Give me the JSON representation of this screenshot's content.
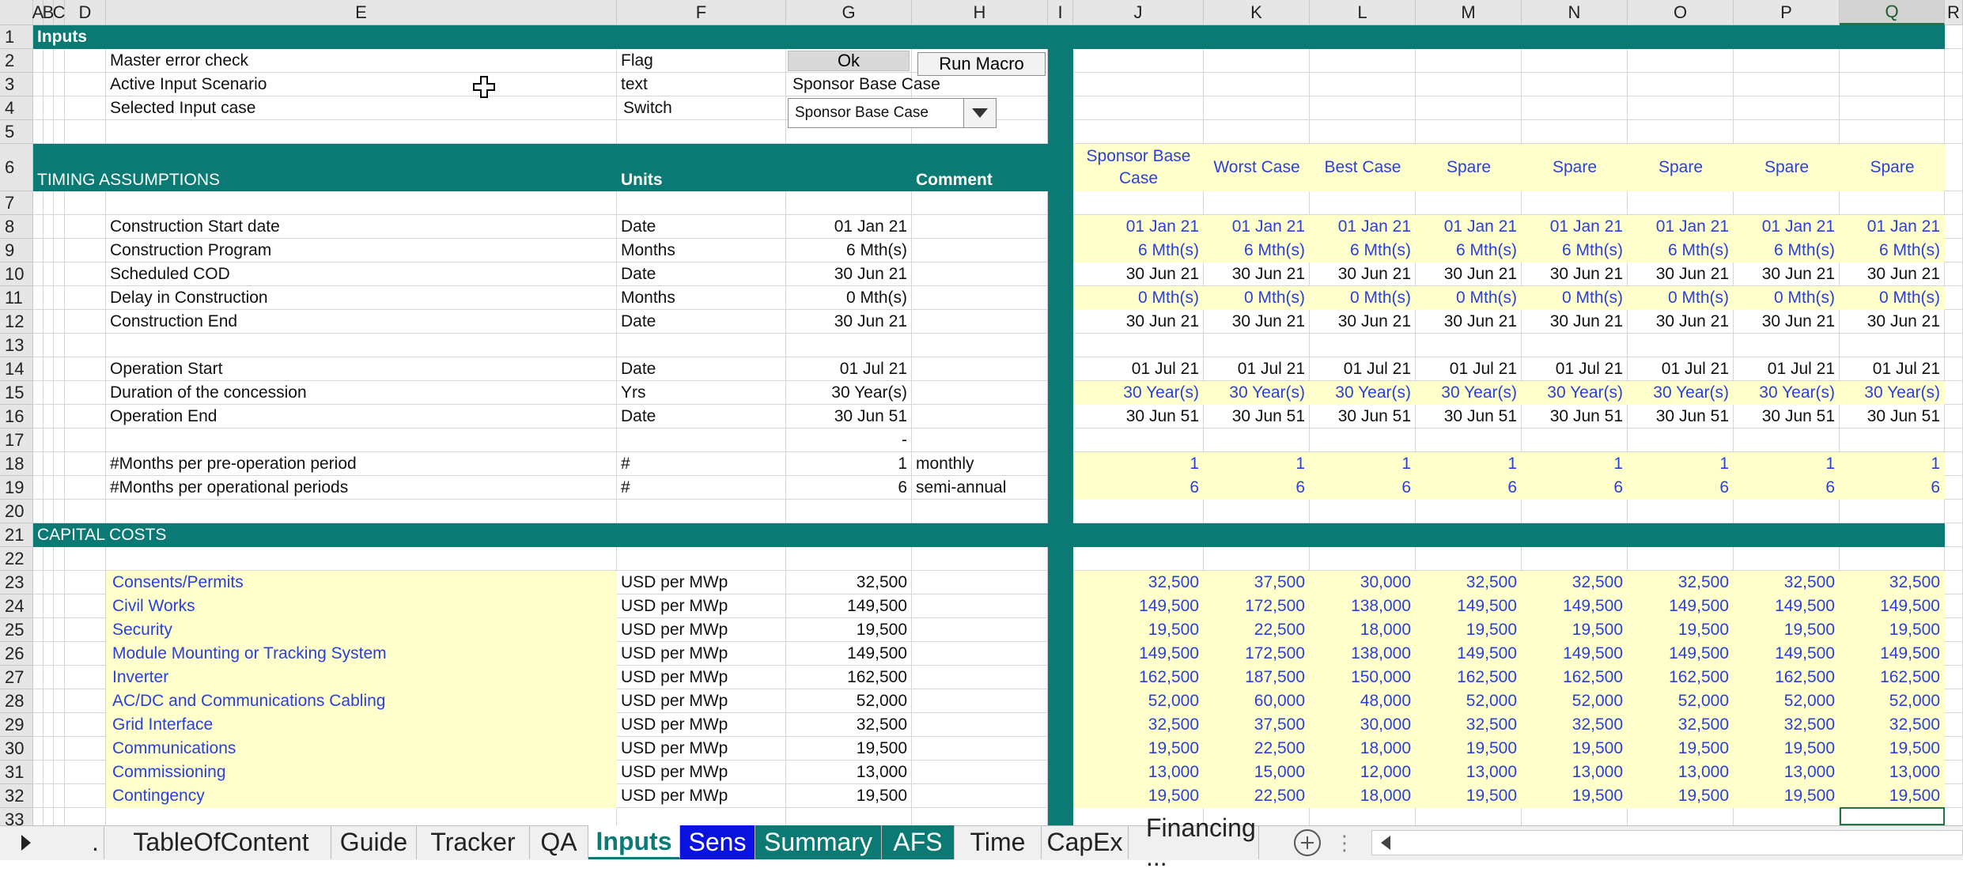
{
  "columns": [
    "A",
    "B",
    "C",
    "D",
    "E",
    "F",
    "G",
    "H",
    "I",
    "J",
    "K",
    "L",
    "M",
    "N",
    "O",
    "P",
    "Q",
    "R"
  ],
  "selected_column": "Q",
  "rows": [
    "1",
    "2",
    "3",
    "4",
    "5",
    "6",
    "7",
    "8",
    "9",
    "10",
    "11",
    "12",
    "13",
    "14",
    "15",
    "16",
    "17",
    "18",
    "19",
    "20",
    "21",
    "22",
    "23",
    "24",
    "25",
    "26",
    "27",
    "28",
    "29",
    "30",
    "31",
    "32",
    "33"
  ],
  "colors": {
    "teal": "#0b7a75",
    "input_yellow": "#ffffcc",
    "input_blue": "#2a3fe0",
    "sens_tab": "#0a12e0"
  },
  "sections": {
    "inputs": "Inputs",
    "timing": "TIMING ASSUMPTIONS",
    "capital": "CAPITAL COSTS"
  },
  "timing_headers": {
    "units": "Units",
    "comment": "Comment"
  },
  "top": {
    "master_error_label": "Master error check",
    "master_error_unit": "Flag",
    "master_error_value": "Ok",
    "run_macro": "Run Macro",
    "scenario_label": "Active Input Scenario",
    "scenario_unit": "text",
    "scenario_value": "Sponsor Base Case",
    "case_label": "Selected Input case",
    "case_unit": "Switch",
    "case_dropdown_value": "Sponsor Base Case",
    "dropdown_arrow": "triangle-down-icon"
  },
  "case_headers": [
    [
      "Sponsor Base",
      "Case"
    ],
    [
      "Worst Case",
      ""
    ],
    [
      "Best Case",
      ""
    ],
    [
      "Spare",
      ""
    ],
    [
      "Spare",
      ""
    ],
    [
      "Spare",
      ""
    ],
    [
      "Spare",
      ""
    ],
    [
      "Spare",
      ""
    ]
  ],
  "timing_rows": [
    {
      "row": 8,
      "label": "Construction Start date",
      "unit": "Date",
      "value": "01 Jan 21",
      "comment": "",
      "input": true,
      "cases": [
        "01 Jan 21",
        "01 Jan 21",
        "01 Jan 21",
        "01 Jan 21",
        "01 Jan 21",
        "01 Jan 21",
        "01 Jan 21",
        "01 Jan 21"
      ]
    },
    {
      "row": 9,
      "label": "Construction Program",
      "unit": "Months",
      "value": "6 Mth(s)",
      "comment": "",
      "input": true,
      "cases": [
        "6 Mth(s)",
        "6 Mth(s)",
        "6 Mth(s)",
        "6 Mth(s)",
        "6 Mth(s)",
        "6 Mth(s)",
        "6 Mth(s)",
        "6 Mth(s)"
      ]
    },
    {
      "row": 10,
      "label": "Scheduled COD",
      "unit": "Date",
      "value": "30 Jun 21",
      "comment": "",
      "input": false,
      "cases": [
        "30 Jun 21",
        "30 Jun 21",
        "30 Jun 21",
        "30 Jun 21",
        "30 Jun 21",
        "30 Jun 21",
        "30 Jun 21",
        "30 Jun 21"
      ]
    },
    {
      "row": 11,
      "label": "Delay in Construction",
      "unit": "Months",
      "value": "0 Mth(s)",
      "comment": "",
      "input": true,
      "cases": [
        "0 Mth(s)",
        "0 Mth(s)",
        "0 Mth(s)",
        "0 Mth(s)",
        "0 Mth(s)",
        "0 Mth(s)",
        "0 Mth(s)",
        "0 Mth(s)"
      ]
    },
    {
      "row": 12,
      "label": "Construction End",
      "unit": "Date",
      "value": "30 Jun 21",
      "comment": "",
      "input": false,
      "cases": [
        "30 Jun 21",
        "30 Jun 21",
        "30 Jun 21",
        "30 Jun 21",
        "30 Jun 21",
        "30 Jun 21",
        "30 Jun 21",
        "30 Jun 21"
      ]
    },
    {
      "row": 14,
      "label": "Operation Start",
      "unit": "Date",
      "value": "01 Jul 21",
      "comment": "",
      "input": false,
      "cases": [
        "01 Jul 21",
        "01 Jul 21",
        "01 Jul 21",
        "01 Jul 21",
        "01 Jul 21",
        "01 Jul 21",
        "01 Jul 21",
        "01 Jul 21"
      ]
    },
    {
      "row": 15,
      "label": "Duration of the concession",
      "unit": "Yrs",
      "value": "30 Year(s)",
      "comment": "",
      "input": true,
      "cases": [
        "30 Year(s)",
        "30 Year(s)",
        "30 Year(s)",
        "30 Year(s)",
        "30 Year(s)",
        "30 Year(s)",
        "30 Year(s)",
        "30 Year(s)"
      ]
    },
    {
      "row": 16,
      "label": "Operation End",
      "unit": "Date",
      "value": "30 Jun 51",
      "comment": "",
      "input": false,
      "cases": [
        "30 Jun 51",
        "30 Jun 51",
        "30 Jun 51",
        "30 Jun 51",
        "30 Jun 51",
        "30 Jun 51",
        "30 Jun 51",
        "30 Jun 51"
      ]
    },
    {
      "row": 17,
      "label": "",
      "unit": "",
      "value": "-",
      "comment": "",
      "input": false,
      "cases": [
        "",
        "",
        "",
        "",
        "",
        "",
        "",
        ""
      ]
    },
    {
      "row": 18,
      "label": "#Months per pre-operation period",
      "unit": "#",
      "value": "1",
      "comment": "monthly",
      "input": true,
      "cases": [
        "1",
        "1",
        "1",
        "1",
        "1",
        "1",
        "1",
        "1"
      ]
    },
    {
      "row": 19,
      "label": "#Months per operational periods",
      "unit": "#",
      "value": "6",
      "comment": "semi-annual",
      "input": true,
      "cases": [
        "6",
        "6",
        "6",
        "6",
        "6",
        "6",
        "6",
        "6"
      ]
    }
  ],
  "capital_rows": [
    {
      "row": 23,
      "label": "Consents/Permits",
      "unit": "USD per MWp",
      "value": "32,500",
      "cases": [
        "32,500",
        "37,500",
        "30,000",
        "32,500",
        "32,500",
        "32,500",
        "32,500",
        "32,500"
      ]
    },
    {
      "row": 24,
      "label": "Civil Works",
      "unit": "USD per MWp",
      "value": "149,500",
      "cases": [
        "149,500",
        "172,500",
        "138,000",
        "149,500",
        "149,500",
        "149,500",
        "149,500",
        "149,500"
      ]
    },
    {
      "row": 25,
      "label": "Security",
      "unit": "USD per MWp",
      "value": "19,500",
      "cases": [
        "19,500",
        "22,500",
        "18,000",
        "19,500",
        "19,500",
        "19,500",
        "19,500",
        "19,500"
      ]
    },
    {
      "row": 26,
      "label": "Module Mounting or Tracking System",
      "unit": "USD per MWp",
      "value": "149,500",
      "cases": [
        "149,500",
        "172,500",
        "138,000",
        "149,500",
        "149,500",
        "149,500",
        "149,500",
        "149,500"
      ]
    },
    {
      "row": 27,
      "label": "Inverter",
      "unit": "USD per MWp",
      "value": "162,500",
      "cases": [
        "162,500",
        "187,500",
        "150,000",
        "162,500",
        "162,500",
        "162,500",
        "162,500",
        "162,500"
      ]
    },
    {
      "row": 28,
      "label": "AC/DC and Communications Cabling",
      "unit": "USD per MWp",
      "value": "52,000",
      "cases": [
        "52,000",
        "60,000",
        "48,000",
        "52,000",
        "52,000",
        "52,000",
        "52,000",
        "52,000"
      ]
    },
    {
      "row": 29,
      "label": "Grid Interface",
      "unit": "USD per MWp",
      "value": "32,500",
      "cases": [
        "32,500",
        "37,500",
        "30,000",
        "32,500",
        "32,500",
        "32,500",
        "32,500",
        "32,500"
      ]
    },
    {
      "row": 30,
      "label": "Communications",
      "unit": "USD per MWp",
      "value": "19,500",
      "cases": [
        "19,500",
        "22,500",
        "18,000",
        "19,500",
        "19,500",
        "19,500",
        "19,500",
        "19,500"
      ]
    },
    {
      "row": 31,
      "label": "Commissioning",
      "unit": "USD per MWp",
      "value": "13,000",
      "cases": [
        "13,000",
        "15,000",
        "12,000",
        "13,000",
        "13,000",
        "13,000",
        "13,000",
        "13,000"
      ]
    },
    {
      "row": 32,
      "label": "Contingency",
      "unit": "USD per MWp",
      "value": "19,500",
      "cases": [
        "19,500",
        "22,500",
        "18,000",
        "19,500",
        "19,500",
        "19,500",
        "19,500",
        "19,500"
      ]
    }
  ],
  "tabs": [
    {
      "label": ".",
      "style": "plain"
    },
    {
      "label": "TableOfContent",
      "style": "plain"
    },
    {
      "label": "Guide",
      "style": "plain"
    },
    {
      "label": "Tracker",
      "style": "plain"
    },
    {
      "label": "QA",
      "style": "plain"
    },
    {
      "label": "Inputs",
      "style": "active"
    },
    {
      "label": "Sens",
      "style": "blue"
    },
    {
      "label": "Summary",
      "style": "teal"
    },
    {
      "label": "AFS",
      "style": "teal"
    },
    {
      "label": "Time",
      "style": "plain"
    },
    {
      "label": "CapEx",
      "style": "plain"
    },
    {
      "label": "Financing ...",
      "style": "plain"
    }
  ],
  "tab_controls": {
    "scroll_icon": "triangle-right-icon",
    "add_sheet": "add-sheet-icon",
    "more": "⋮",
    "scroll_left": "triangle-left-icon"
  }
}
